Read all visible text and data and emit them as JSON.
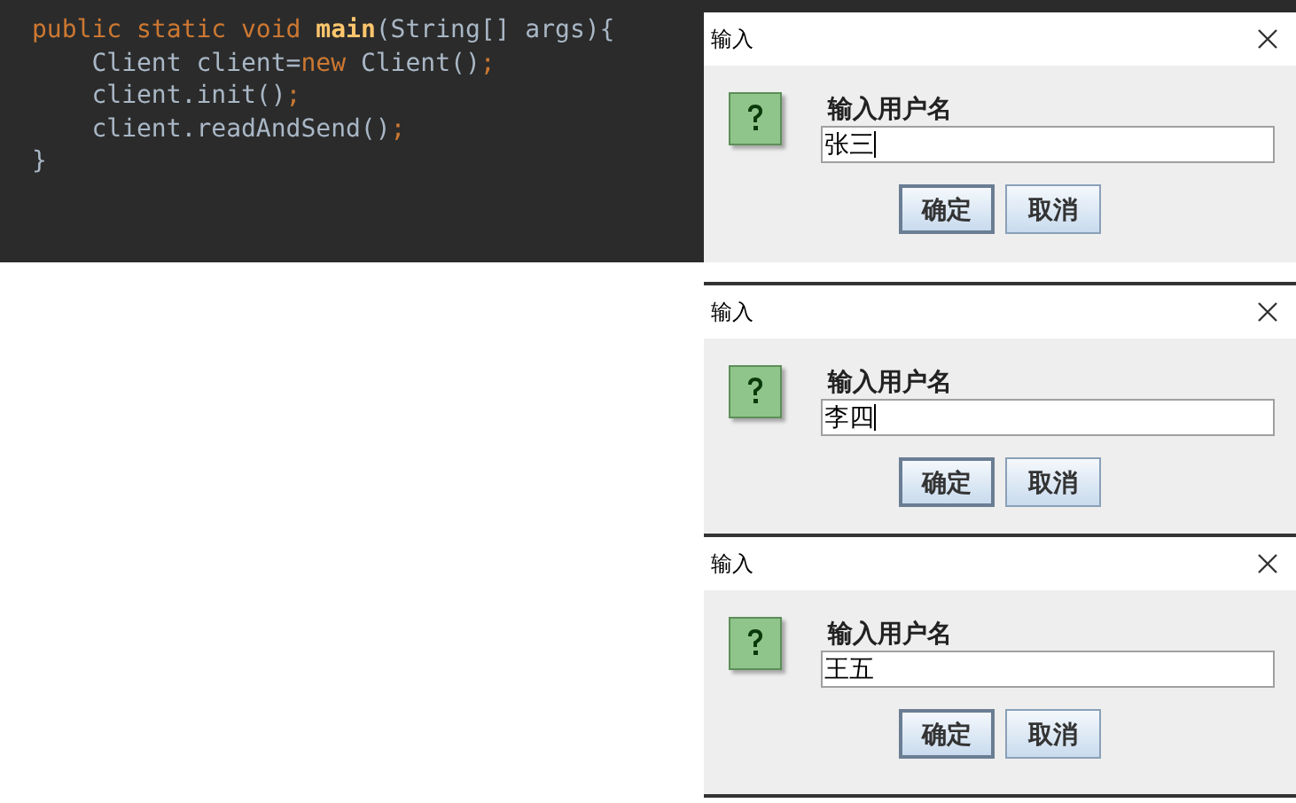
{
  "code_editor": {
    "lines": [
      [
        {
          "kind": "keyword",
          "text": "public static void "
        },
        {
          "kind": "method",
          "text": "main"
        },
        {
          "kind": "plain",
          "text": "(String[] args){"
        }
      ],
      [
        {
          "kind": "plain",
          "text": "    Client client="
        },
        {
          "kind": "keyword",
          "text": "new"
        },
        {
          "kind": "plain",
          "text": " Client()"
        },
        {
          "kind": "keyword",
          "text": ";"
        }
      ],
      [
        {
          "kind": "plain",
          "text": "    client.init()"
        },
        {
          "kind": "keyword",
          "text": ";"
        }
      ],
      [
        {
          "kind": "plain",
          "text": "    client.readAndSend()"
        },
        {
          "kind": "keyword",
          "text": ";"
        }
      ],
      [
        {
          "kind": "plain",
          "text": "}"
        }
      ]
    ]
  },
  "dialogs": [
    {
      "title": "输入",
      "prompt": "输入用户名",
      "value": "张三",
      "focused": true,
      "buttons": [
        {
          "label": "确定",
          "default": true
        },
        {
          "label": "取消",
          "default": false
        }
      ]
    },
    {
      "title": "输入",
      "prompt": "输入用户名",
      "value": "李四",
      "focused": true,
      "buttons": [
        {
          "label": "确定",
          "default": true
        },
        {
          "label": "取消",
          "default": false
        }
      ]
    },
    {
      "title": "输入",
      "prompt": "输入用户名",
      "value": "王五",
      "focused": false,
      "buttons": [
        {
          "label": "确定",
          "default": true
        },
        {
          "label": "取消",
          "default": false
        }
      ]
    }
  ]
}
